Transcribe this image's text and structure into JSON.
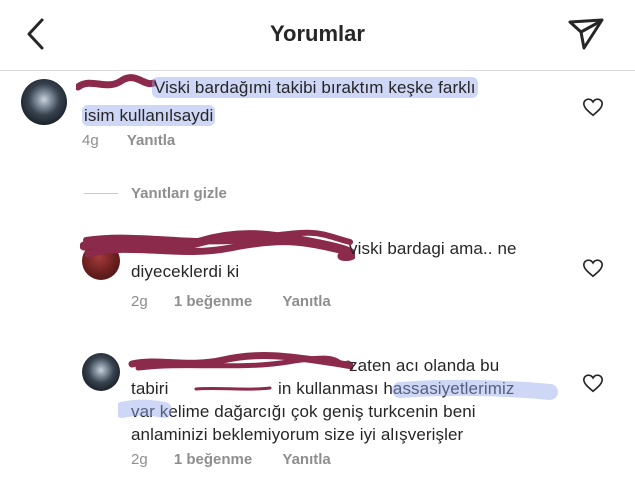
{
  "header": {
    "title": "Yorumlar",
    "back_icon": "chevron-left-icon",
    "send_icon": "send-icon"
  },
  "comment1": {
    "text_line1": "Viski bardağımi takibi bıraktım keşke farklı",
    "text_line2": "isim kullanılsaydi",
    "time": "4g",
    "reply_label": "Yanıtla"
  },
  "replies_toggle": "Yanıtları gizle",
  "reply1": {
    "text_line1": "viski bardagi ama.. ne",
    "text_line2": "diyeceklerdi ki",
    "time": "2g",
    "likes": "1 beğenme",
    "reply_label": "Yanıtla"
  },
  "reply2": {
    "text_line1": "zaten acı olanda bu",
    "text_line2a": "tabiri",
    "text_line2b": "in kullanması hassasiyetlerimiz",
    "text_line3": "var kelime dağarcığı çok geniş turkcenin beni",
    "text_line4": "anlaminizi beklemiyorum size iyi alışverişler",
    "time": "2g",
    "likes": "1 beğenme",
    "reply_label": "Yanıtla"
  },
  "icons": {
    "like": "heart-icon",
    "redaction": "scribble-redaction"
  },
  "colors": {
    "text": "#262626",
    "muted": "#8e8e8e",
    "highlight": "#92a6ec",
    "redaction": "#8b2a4a"
  }
}
